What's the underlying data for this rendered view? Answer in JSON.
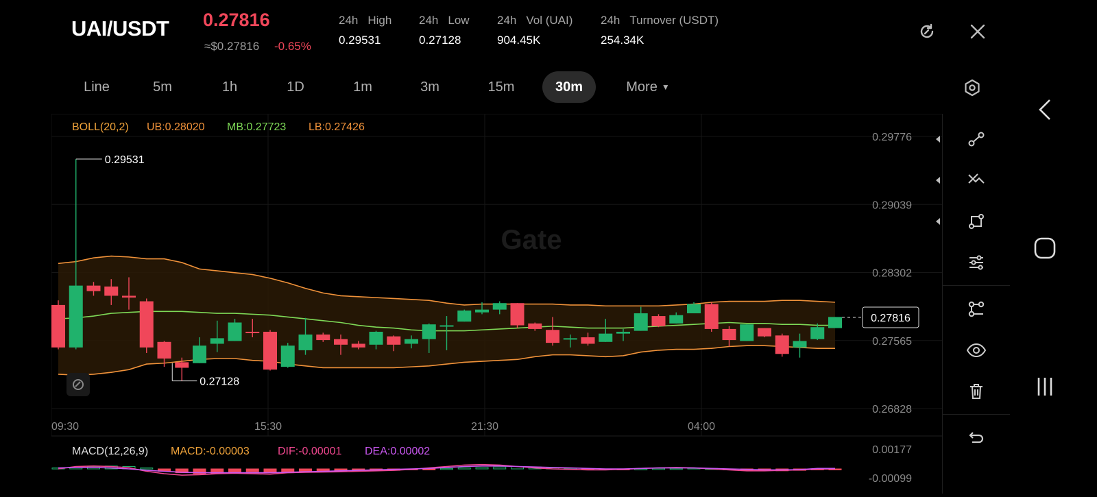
{
  "header": {
    "pair": "UAI/USDT",
    "last_price": "0.27816",
    "price_usd": "≈$0.27816",
    "change_pct": "-0.65%",
    "stats": [
      {
        "period": "24h",
        "label": "High",
        "value": "0.29531"
      },
      {
        "period": "24h",
        "label": "Low",
        "value": "0.27128"
      },
      {
        "period": "24h",
        "label": "Vol (UAI)",
        "value": "904.45K"
      },
      {
        "period": "24h",
        "label": "Turnover (USDT)",
        "value": "254.34K"
      }
    ],
    "icons": {
      "refresh": "refresh-icon",
      "close": "close-icon"
    }
  },
  "timeframes": {
    "items": [
      "Line",
      "5m",
      "1h",
      "1D",
      "1m",
      "3m",
      "15m",
      "30m"
    ],
    "active": "30m",
    "more_label": "More"
  },
  "chart": {
    "watermark": "Gate",
    "boll": {
      "label": "BOLL(20,2)",
      "ub": "UB:0.28020",
      "mb": "MB:0.27723",
      "lb": "LB:0.27426"
    },
    "macd": {
      "label": "MACD(12,26,9)",
      "macd": "MACD:-0.00003",
      "dif": "DIF:-0.00001",
      "dea": "DEA:0.00002"
    },
    "colors": {
      "up": "#20b26c",
      "down": "#f0475a",
      "ub": "#f0923a",
      "mb": "#7ed957",
      "lb": "#f0923a",
      "macd": "#f0a33a",
      "dif": "#f0478f",
      "dea": "#c957f0"
    }
  },
  "chart_data": {
    "type": "candlestick",
    "x_labels": [
      "09:30",
      "15:30",
      "21:30",
      "04:00"
    ],
    "y_ticks": [
      "0.29776",
      "0.29039",
      "0.28302",
      "0.27565",
      "0.26828"
    ],
    "ylim": [
      0.26828,
      0.29776
    ],
    "high_marker": "0.29531",
    "low_marker": "0.27128",
    "last_price_tag": "0.27816",
    "macd_ticks": [
      "0.00177",
      "-0.00099"
    ],
    "candles": [
      {
        "o": 0.2795,
        "h": 0.28,
        "l": 0.2747,
        "c": 0.2749
      },
      {
        "o": 0.2749,
        "h": 0.2953,
        "l": 0.2747,
        "c": 0.2816
      },
      {
        "o": 0.2816,
        "h": 0.282,
        "l": 0.2805,
        "c": 0.281
      },
      {
        "o": 0.2815,
        "h": 0.2823,
        "l": 0.2795,
        "c": 0.2805
      },
      {
        "o": 0.2805,
        "h": 0.2825,
        "l": 0.279,
        "c": 0.2803
      },
      {
        "o": 0.2799,
        "h": 0.2802,
        "l": 0.2743,
        "c": 0.2749
      },
      {
        "o": 0.2755,
        "h": 0.2756,
        "l": 0.2728,
        "c": 0.2737
      },
      {
        "o": 0.2733,
        "h": 0.2738,
        "l": 0.2713,
        "c": 0.2727
      },
      {
        "o": 0.2732,
        "h": 0.276,
        "l": 0.2732,
        "c": 0.2751
      },
      {
        "o": 0.2753,
        "h": 0.2778,
        "l": 0.2744,
        "c": 0.2759
      },
      {
        "o": 0.2756,
        "h": 0.278,
        "l": 0.2756,
        "c": 0.2776
      },
      {
        "o": 0.2766,
        "h": 0.278,
        "l": 0.276,
        "c": 0.2765
      },
      {
        "o": 0.2766,
        "h": 0.2768,
        "l": 0.2724,
        "c": 0.2725
      },
      {
        "o": 0.2728,
        "h": 0.2754,
        "l": 0.2727,
        "c": 0.2751
      },
      {
        "o": 0.2746,
        "h": 0.2781,
        "l": 0.2741,
        "c": 0.2763
      },
      {
        "o": 0.2763,
        "h": 0.2765,
        "l": 0.2755,
        "c": 0.2757
      },
      {
        "o": 0.2758,
        "h": 0.2763,
        "l": 0.2741,
        "c": 0.2752
      },
      {
        "o": 0.2753,
        "h": 0.2756,
        "l": 0.2747,
        "c": 0.2749
      },
      {
        "o": 0.2752,
        "h": 0.2767,
        "l": 0.2747,
        "c": 0.2766
      },
      {
        "o": 0.2761,
        "h": 0.2762,
        "l": 0.2745,
        "c": 0.2752
      },
      {
        "o": 0.2753,
        "h": 0.2762,
        "l": 0.2748,
        "c": 0.2758
      },
      {
        "o": 0.2758,
        "h": 0.2775,
        "l": 0.2743,
        "c": 0.2774
      },
      {
        "o": 0.2773,
        "h": 0.2783,
        "l": 0.2746,
        "c": 0.2773
      },
      {
        "o": 0.2777,
        "h": 0.279,
        "l": 0.2777,
        "c": 0.2789
      },
      {
        "o": 0.2787,
        "h": 0.2798,
        "l": 0.2785,
        "c": 0.279
      },
      {
        "o": 0.279,
        "h": 0.2799,
        "l": 0.2785,
        "c": 0.2797
      },
      {
        "o": 0.2797,
        "h": 0.2797,
        "l": 0.277,
        "c": 0.2773
      },
      {
        "o": 0.2775,
        "h": 0.2776,
        "l": 0.2767,
        "c": 0.2769
      },
      {
        "o": 0.2768,
        "h": 0.2782,
        "l": 0.2751,
        "c": 0.2754
      },
      {
        "o": 0.2758,
        "h": 0.2763,
        "l": 0.2749,
        "c": 0.2759
      },
      {
        "o": 0.276,
        "h": 0.2765,
        "l": 0.2751,
        "c": 0.2753
      },
      {
        "o": 0.2755,
        "h": 0.278,
        "l": 0.2755,
        "c": 0.2764
      },
      {
        "o": 0.2764,
        "h": 0.2769,
        "l": 0.2756,
        "c": 0.2766
      },
      {
        "o": 0.2767,
        "h": 0.2793,
        "l": 0.2767,
        "c": 0.2786
      },
      {
        "o": 0.2783,
        "h": 0.2785,
        "l": 0.2771,
        "c": 0.2772
      },
      {
        "o": 0.2775,
        "h": 0.2787,
        "l": 0.2775,
        "c": 0.2784
      },
      {
        "o": 0.2786,
        "h": 0.2798,
        "l": 0.2786,
        "c": 0.2796
      },
      {
        "o": 0.2796,
        "h": 0.2798,
        "l": 0.2766,
        "c": 0.2769
      },
      {
        "o": 0.2769,
        "h": 0.2772,
        "l": 0.275,
        "c": 0.2757
      },
      {
        "o": 0.2756,
        "h": 0.2774,
        "l": 0.2756,
        "c": 0.2774
      },
      {
        "o": 0.277,
        "h": 0.277,
        "l": 0.276,
        "c": 0.2761
      },
      {
        "o": 0.2762,
        "h": 0.2764,
        "l": 0.2739,
        "c": 0.2742
      },
      {
        "o": 0.2749,
        "h": 0.2764,
        "l": 0.2738,
        "c": 0.2756
      },
      {
        "o": 0.2758,
        "h": 0.2775,
        "l": 0.2757,
        "c": 0.2771
      },
      {
        "o": 0.277,
        "h": 0.2782,
        "l": 0.277,
        "c": 0.2782
      }
    ],
    "ub": [
      0.284,
      0.2842,
      0.2846,
      0.2848,
      0.2847,
      0.2845,
      0.2845,
      0.2841,
      0.2834,
      0.2832,
      0.283,
      0.2828,
      0.2824,
      0.2819,
      0.2813,
      0.2808,
      0.2805,
      0.2804,
      0.2803,
      0.2802,
      0.2801,
      0.28,
      0.2797,
      0.2795,
      0.2796,
      0.2796,
      0.2796,
      0.2796,
      0.2796,
      0.2795,
      0.2795,
      0.2794,
      0.2794,
      0.2794,
      0.2794,
      0.2795,
      0.2796,
      0.2798,
      0.2799,
      0.2799,
      0.2799,
      0.28,
      0.28,
      0.2799,
      0.2798
    ],
    "mb": [
      0.278,
      0.2781,
      0.2783,
      0.2786,
      0.2787,
      0.2788,
      0.2788,
      0.2788,
      0.2787,
      0.2786,
      0.2786,
      0.2785,
      0.2784,
      0.2782,
      0.278,
      0.2778,
      0.2776,
      0.2773,
      0.2771,
      0.277,
      0.2768,
      0.2767,
      0.2767,
      0.2767,
      0.2768,
      0.2769,
      0.277,
      0.2771,
      0.2772,
      0.2771,
      0.277,
      0.277,
      0.277,
      0.2771,
      0.2772,
      0.2773,
      0.2774,
      0.2775,
      0.2776,
      0.2775,
      0.2775,
      0.2774,
      0.2774,
      0.2773,
      0.2773
    ],
    "lb": [
      0.272,
      0.2719,
      0.272,
      0.2722,
      0.2725,
      0.2731,
      0.2732,
      0.2734,
      0.2736,
      0.2737,
      0.2737,
      0.2735,
      0.2734,
      0.2731,
      0.2729,
      0.2727,
      0.2727,
      0.2727,
      0.2727,
      0.2727,
      0.2728,
      0.2729,
      0.2731,
      0.2733,
      0.2734,
      0.2735,
      0.2736,
      0.2739,
      0.2741,
      0.2741,
      0.274,
      0.2739,
      0.274,
      0.2744,
      0.2746,
      0.2747,
      0.2747,
      0.2748,
      0.275,
      0.2751,
      0.2751,
      0.275,
      0.2749,
      0.2748,
      0.2748
    ],
    "macd_hist": [
      4e-05,
      6e-05,
      0.0001,
      0.00012,
      0.0001,
      4e-05,
      -0.0001,
      -0.00016,
      -0.0002,
      -0.0002,
      -0.00016,
      -0.00012,
      -0.00014,
      -0.00016,
      -0.00012,
      -0.00012,
      -0.0001,
      -8e-05,
      -6e-05,
      -6e-05,
      -4e-05,
      -2e-05,
      2e-05,
      4e-05,
      6e-05,
      8e-05,
      0.0001,
      8e-05,
      4e-05,
      2e-05,
      -2e-05,
      -2e-05,
      -2e-05,
      0.0,
      2e-05,
      2e-05,
      4e-05,
      2e-05,
      -2e-05,
      -4e-05,
      -6e-05,
      -8e-05,
      -6e-05,
      -3e-05,
      -3e-05
    ],
    "dif": [
      0.0,
      0.0001,
      0.00012,
      0.0001,
      5e-05,
      -0.0001,
      -0.0002,
      -0.00026,
      -0.00024,
      -0.0002,
      -0.00018,
      -0.0002,
      -0.00022,
      -0.00016,
      -0.00014,
      -0.00013,
      -0.00012,
      -0.0001,
      -8e-05,
      -6e-05,
      -2e-05,
      4e-05,
      0.0001,
      0.00016,
      0.00018,
      0.00016,
      0.0001,
      4e-05,
      0.0,
      -2e-05,
      -4e-05,
      -4e-05,
      -2e-05,
      2e-05,
      4e-05,
      6e-05,
      4e-05,
      0.0,
      -4e-05,
      -8e-05,
      -8e-05,
      -6e-05,
      -4e-05,
      -1e-05,
      -1e-05
    ],
    "dea": [
      4e-05,
      6e-05,
      6e-05,
      4e-05,
      0.0,
      -6e-05,
      -0.0001,
      -0.00014,
      -0.00016,
      -0.00016,
      -0.00016,
      -0.00016,
      -0.00016,
      -0.00014,
      -0.00012,
      -0.0001,
      -8e-05,
      -6e-05,
      -4e-05,
      -2e-05,
      0.0,
      2e-05,
      6e-05,
      0.0001,
      0.00012,
      0.00012,
      0.0001,
      8e-05,
      6e-05,
      4e-05,
      2e-05,
      0.0,
      0.0,
      2e-05,
      4e-05,
      4e-05,
      4e-05,
      2e-05,
      0.0,
      -2e-05,
      -4e-05,
      -4e-05,
      -3e-05,
      2e-05,
      2e-05
    ]
  },
  "right_tools": [
    {
      "name": "trend-line-icon"
    },
    {
      "name": "multi-line-icon"
    },
    {
      "name": "shape-icon"
    },
    {
      "name": "indicator-settings-icon"
    },
    {
      "name": "compare-icon"
    },
    {
      "name": "eye-icon"
    },
    {
      "name": "trash-icon"
    },
    {
      "name": "undo-icon"
    }
  ]
}
